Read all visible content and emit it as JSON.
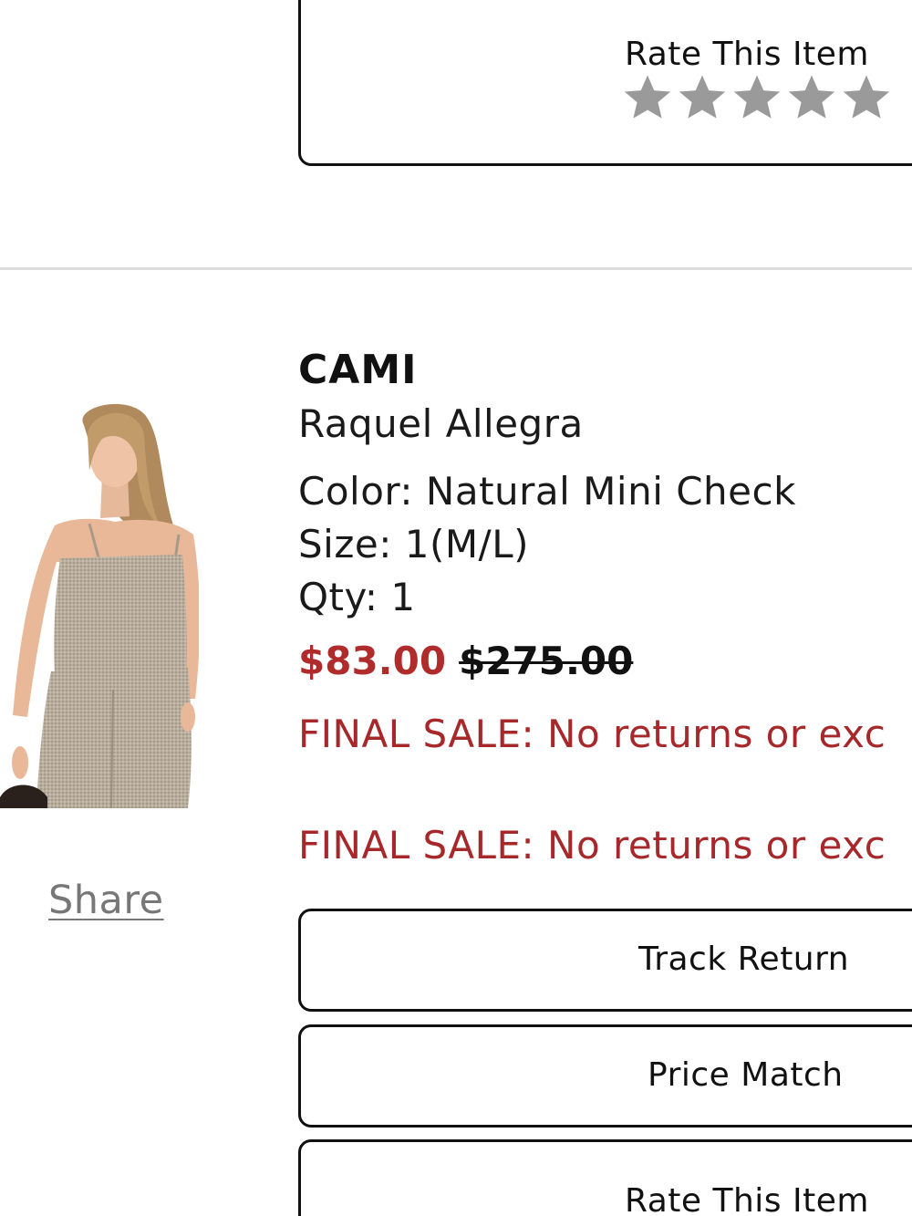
{
  "top_rating": {
    "label": "Rate This Item",
    "stars_total": 5,
    "stars_selected": 0,
    "star_color": "#9a9a9a"
  },
  "product": {
    "name": "CAMI",
    "brand": "Raquel Allegra",
    "color_line": "Color: Natural Mini Check",
    "size_line": "Size: 1(M/L)",
    "qty_line": "Qty: 1",
    "sale_price": "$83.00",
    "original_price": "$275.00",
    "final_sale_notice_1": "FINAL SALE: No returns or exc",
    "final_sale_notice_2": "FINAL SALE: No returns or exc",
    "image_icon": "product-photo-icon"
  },
  "share": {
    "label": "Share"
  },
  "actions": {
    "track_return": "Track Return",
    "price_match": "Price Match",
    "rate_item": "Rate This Item"
  },
  "colors": {
    "sale_red": "#b02b2b",
    "final_sale_red": "#a7282a",
    "border": "#111111",
    "divider": "#dddddd",
    "share_gray": "#777777"
  }
}
